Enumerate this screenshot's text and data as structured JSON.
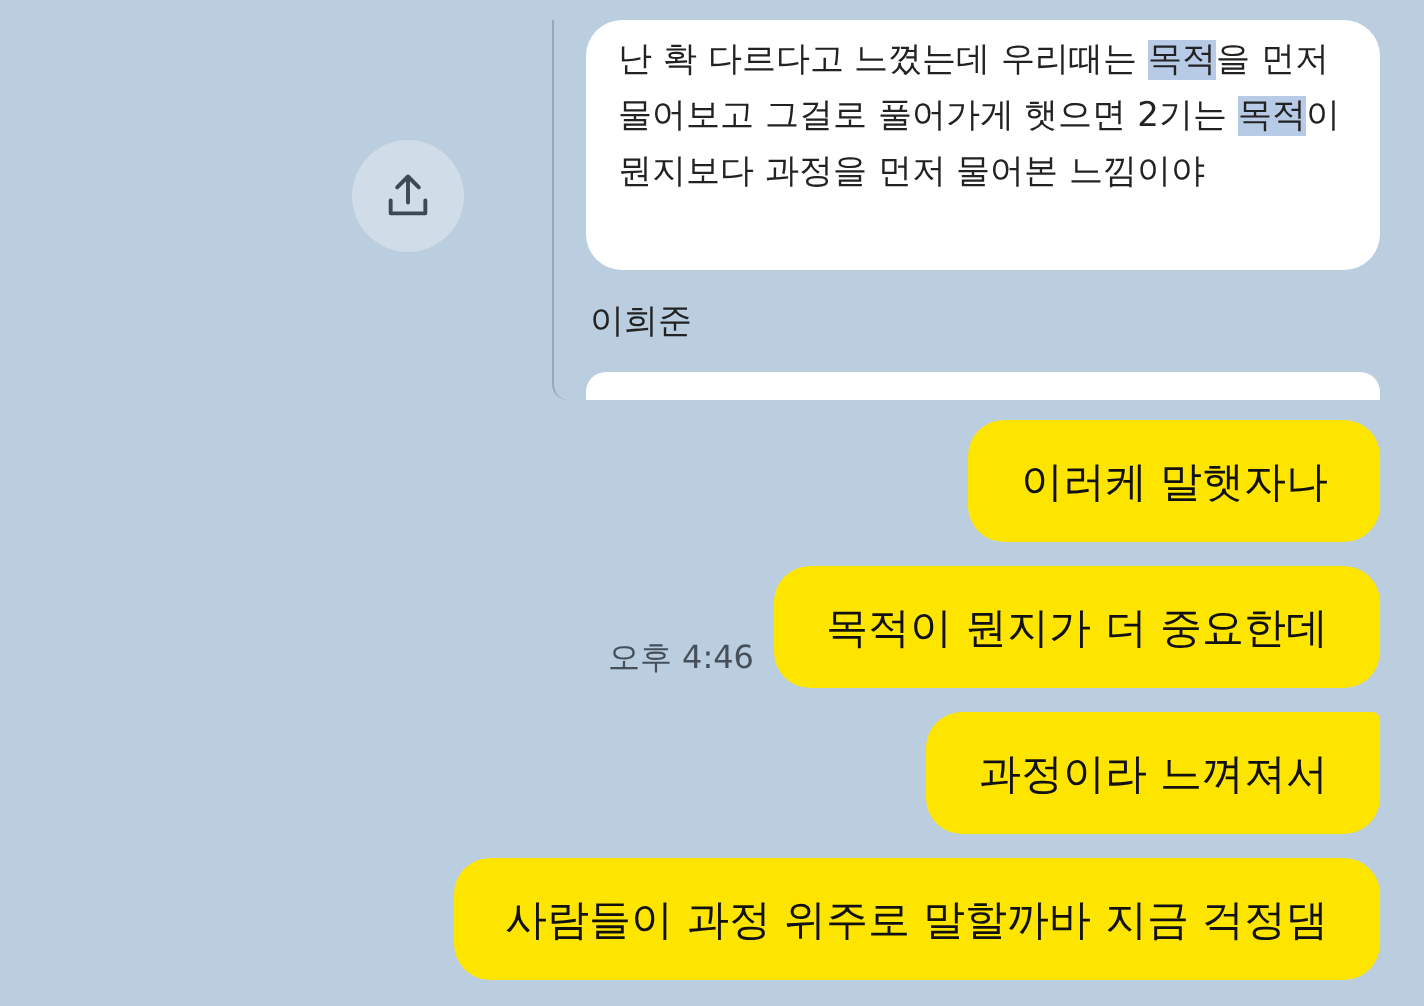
{
  "quote": {
    "segments": [
      {
        "text": "난 확 다르다고 느꼈는데 우리때는 ",
        "highlighted": false
      },
      {
        "text": "목적",
        "highlighted": true
      },
      {
        "text": "을 먼저 물어보고 그걸로 풀어가게 햇으면 2기는 ",
        "highlighted": false
      },
      {
        "text": "목적",
        "highlighted": true
      },
      {
        "text": "이 뭔지보다 과정을 먼저 물어본 느낌이야",
        "highlighted": false
      }
    ],
    "sender": "이희준"
  },
  "messages": [
    {
      "text": "이러케 말햇자나",
      "tail": false
    },
    {
      "text": "목적이 뭔지가 더 중요한데",
      "time": "오후 4:46",
      "tail": false
    },
    {
      "text": "과정이라 느껴져서",
      "tail": true
    },
    {
      "text": "사람들이 과정 위주로 말할까바 지금 걱정댐",
      "tail": false
    }
  ]
}
